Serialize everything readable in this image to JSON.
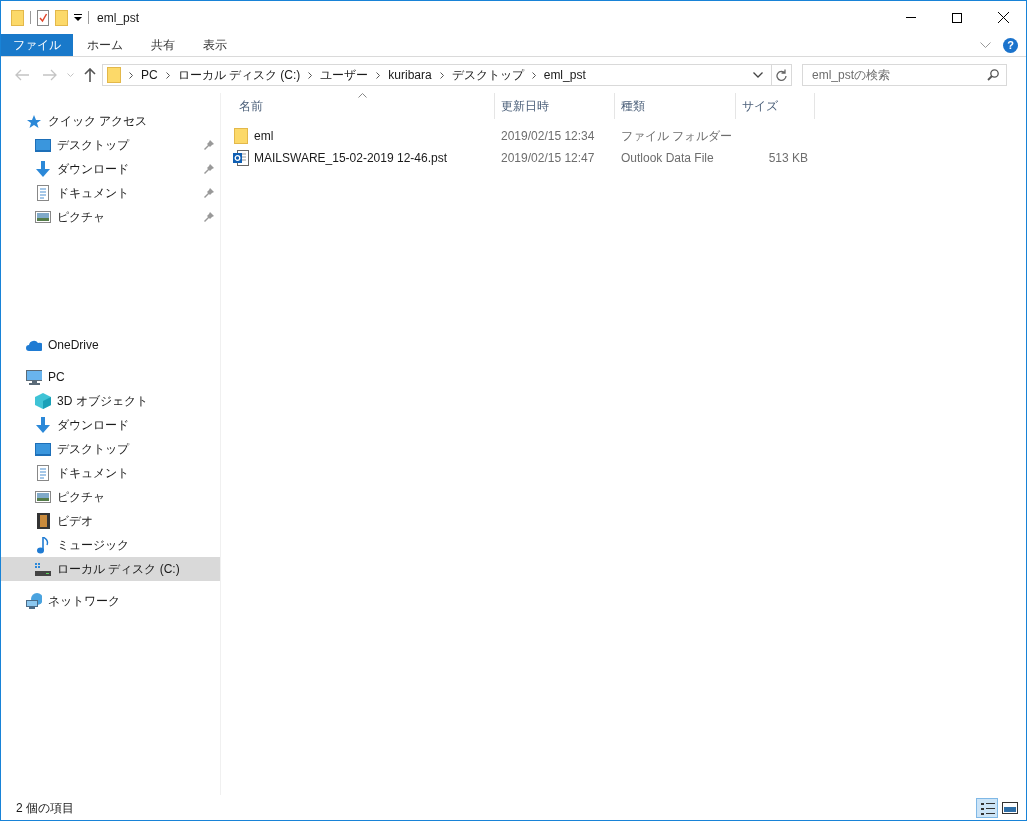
{
  "window": {
    "title": "eml_pst"
  },
  "ribbon": {
    "tabs": [
      {
        "label": "ファイル",
        "selected": true
      },
      {
        "label": "ホーム",
        "selected": false
      },
      {
        "label": "共有",
        "selected": false
      },
      {
        "label": "表示",
        "selected": false
      }
    ],
    "help": "?"
  },
  "address": {
    "crumbs": [
      "PC",
      "ローカル ディスク (C:)",
      "ユーザー",
      "kuribara",
      "デスクトップ",
      "eml_pst"
    ]
  },
  "search": {
    "placeholder": "eml_pstの検索"
  },
  "sidebar": {
    "sections": [
      {
        "label": "クイック アクセス",
        "kind": "star",
        "selected": false,
        "children": [
          {
            "label": "デスクトップ",
            "kind": "desktop",
            "pinned": true,
            "selected": false
          },
          {
            "label": "ダウンロード",
            "kind": "download",
            "pinned": true,
            "selected": false
          },
          {
            "label": "ドキュメント",
            "kind": "document",
            "pinned": true,
            "selected": false
          },
          {
            "label": "ピクチャ",
            "kind": "picture",
            "pinned": true,
            "selected": false
          }
        ]
      },
      {
        "label": "OneDrive",
        "kind": "cloud",
        "selected": false
      },
      {
        "label": "PC",
        "kind": "pc",
        "selected": false,
        "children": [
          {
            "label": "3D オブジェクト",
            "kind": "cube",
            "pinned": false,
            "selected": false
          },
          {
            "label": "ダウンロード",
            "kind": "download",
            "pinned": false,
            "selected": false
          },
          {
            "label": "デスクトップ",
            "kind": "desktop",
            "pinned": false,
            "selected": false
          },
          {
            "label": "ドキュメント",
            "kind": "document",
            "pinned": false,
            "selected": false
          },
          {
            "label": "ピクチャ",
            "kind": "picture",
            "pinned": false,
            "selected": false
          },
          {
            "label": "ビデオ",
            "kind": "video",
            "pinned": false,
            "selected": false
          },
          {
            "label": "ミュージック",
            "kind": "music",
            "pinned": false,
            "selected": false
          },
          {
            "label": "ローカル ディスク (C:)",
            "kind": "drive",
            "pinned": false,
            "selected": true
          }
        ]
      },
      {
        "label": "ネットワーク",
        "kind": "network",
        "selected": false
      }
    ]
  },
  "table": {
    "columns": [
      "名前",
      "更新日時",
      "種類",
      "サイズ"
    ],
    "rows": [
      {
        "kind": "folder",
        "name": "eml",
        "modified": "2019/02/15 12:34",
        "type": "ファイル フォルダー",
        "size": ""
      },
      {
        "kind": "pst",
        "name": "MAILSWARE_15-02-2019 12-46.pst",
        "modified": "2019/02/15 12:47",
        "type": "Outlook Data File",
        "size": "513 KB"
      }
    ]
  },
  "status_bar": {
    "text": "2 個の項目"
  }
}
